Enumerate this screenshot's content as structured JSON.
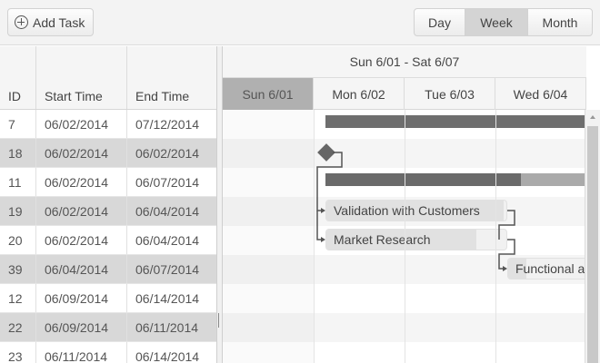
{
  "toolbar": {
    "add_task_label": "Add Task",
    "views": [
      "Day",
      "Week",
      "Month"
    ],
    "selected_view": "Week"
  },
  "grid": {
    "columns": [
      "ID",
      "Start Time",
      "End Time"
    ],
    "rows": [
      {
        "id": "7",
        "start": "06/02/2014",
        "end": "07/12/2014"
      },
      {
        "id": "18",
        "start": "06/02/2014",
        "end": "06/02/2014"
      },
      {
        "id": "11",
        "start": "06/02/2014",
        "end": "06/07/2014"
      },
      {
        "id": "19",
        "start": "06/02/2014",
        "end": "06/04/2014"
      },
      {
        "id": "20",
        "start": "06/02/2014",
        "end": "06/04/2014"
      },
      {
        "id": "39",
        "start": "06/04/2014",
        "end": "06/07/2014"
      },
      {
        "id": "12",
        "start": "06/09/2014",
        "end": "06/14/2014"
      },
      {
        "id": "22",
        "start": "06/09/2014",
        "end": "06/11/2014"
      },
      {
        "id": "23",
        "start": "06/11/2014",
        "end": "06/14/2014"
      }
    ]
  },
  "timeline": {
    "week_label": "Sun 6/01 - Sat 6/07",
    "days": [
      "Sun 6/01",
      "Mon 6/02",
      "Tue 6/03",
      "Wed 6/04"
    ],
    "tasks": [
      {
        "title": "Validation with Customers"
      },
      {
        "title": "Market Research"
      },
      {
        "title": "Functional a"
      }
    ]
  },
  "colors": {
    "summary_bar": "#6e6e6e",
    "selected_view_bg": "#d4d4d4",
    "today_header_bg": "#b0b0b0",
    "alt_row_bg": "#d8d8d8"
  }
}
